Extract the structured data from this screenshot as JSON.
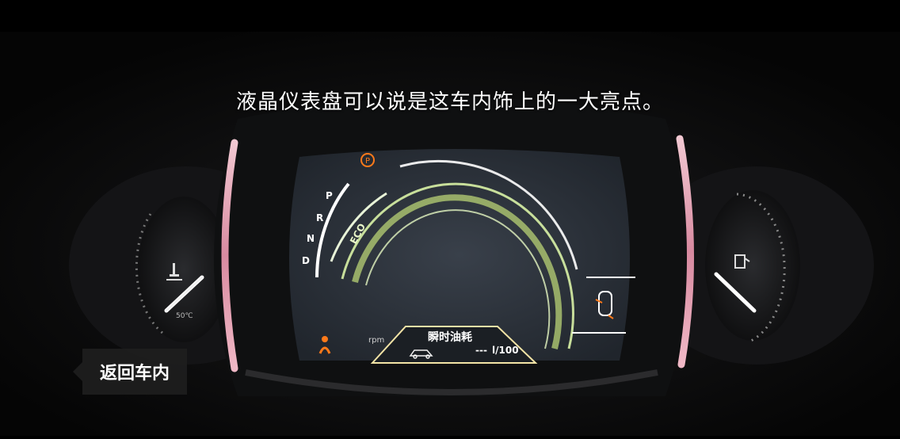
{
  "caption": "液晶仪表盘可以说是这车内饰上的一大亮点。",
  "back_button_label": "返回车内",
  "cluster": {
    "gears": [
      "P",
      "R",
      "N",
      "D"
    ],
    "eco_label": "ECO",
    "rpm_label": "rpm",
    "info_title": "瞬时油耗",
    "info_value": "---",
    "info_unit": "l/100",
    "left_gauge_label": "50℃"
  },
  "colors": {
    "accent_green": "#d9f2a6",
    "warning_orange": "#ff7a1a",
    "screen_bg": "#2a3038"
  },
  "icons": [
    "parking-brake-icon",
    "seatbelt-icon",
    "door-open-icon",
    "coolant-temp-icon",
    "fuel-pump-icon",
    "car-icon"
  ]
}
